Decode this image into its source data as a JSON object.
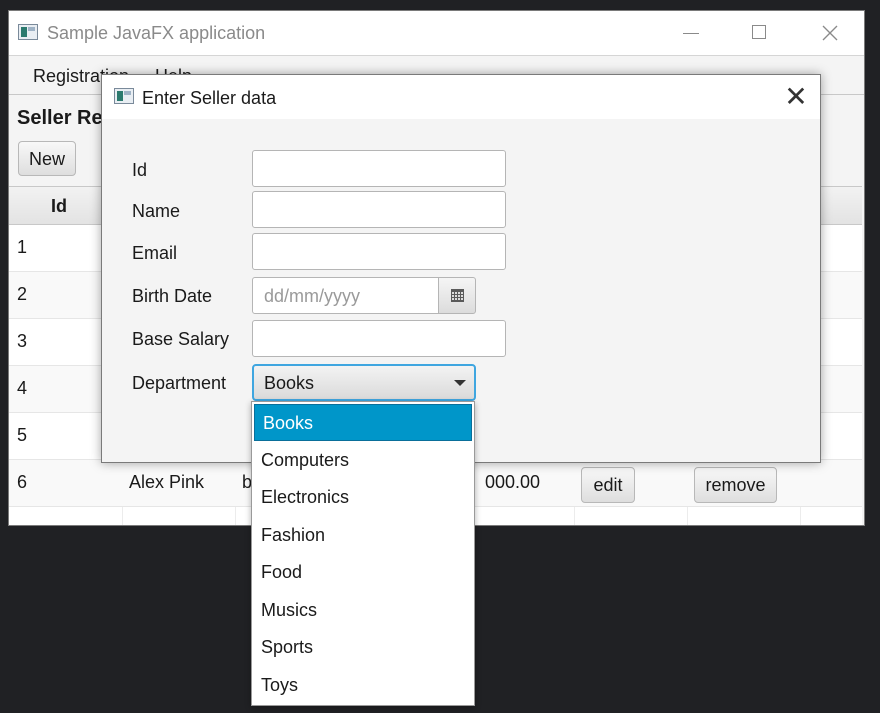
{
  "main_window": {
    "title": "Sample JavaFX application",
    "menu": [
      "Registration",
      "Help"
    ],
    "page_title": "Seller Re",
    "new_button": "New",
    "table": {
      "header_id": "Id",
      "row_ids": [
        "1",
        "2",
        "3",
        "4",
        "5",
        "6"
      ],
      "row6": {
        "name": "Alex Pink",
        "email": "b",
        "salary": "000.00",
        "edit": "edit",
        "remove": "remove"
      }
    }
  },
  "dialog": {
    "title": "Enter Seller data",
    "close_glyph": "✕",
    "labels": {
      "id": "Id",
      "name": "Name",
      "email": "Email",
      "birth_date": "Birth Date",
      "base_salary": "Base Salary",
      "department": "Department"
    },
    "birth_date_placeholder": "dd/mm/yyyy",
    "department_selected": "Books"
  },
  "dropdown_options": [
    "Books",
    "Computers",
    "Electronics",
    "Fashion",
    "Food",
    "Musics",
    "Sports",
    "Toys"
  ],
  "colors": {
    "selection": "#0096c9",
    "focus_border": "#3fa6e0"
  },
  "icons": {
    "app": "javafx-app-icon",
    "calendar": "calendar-icon"
  }
}
